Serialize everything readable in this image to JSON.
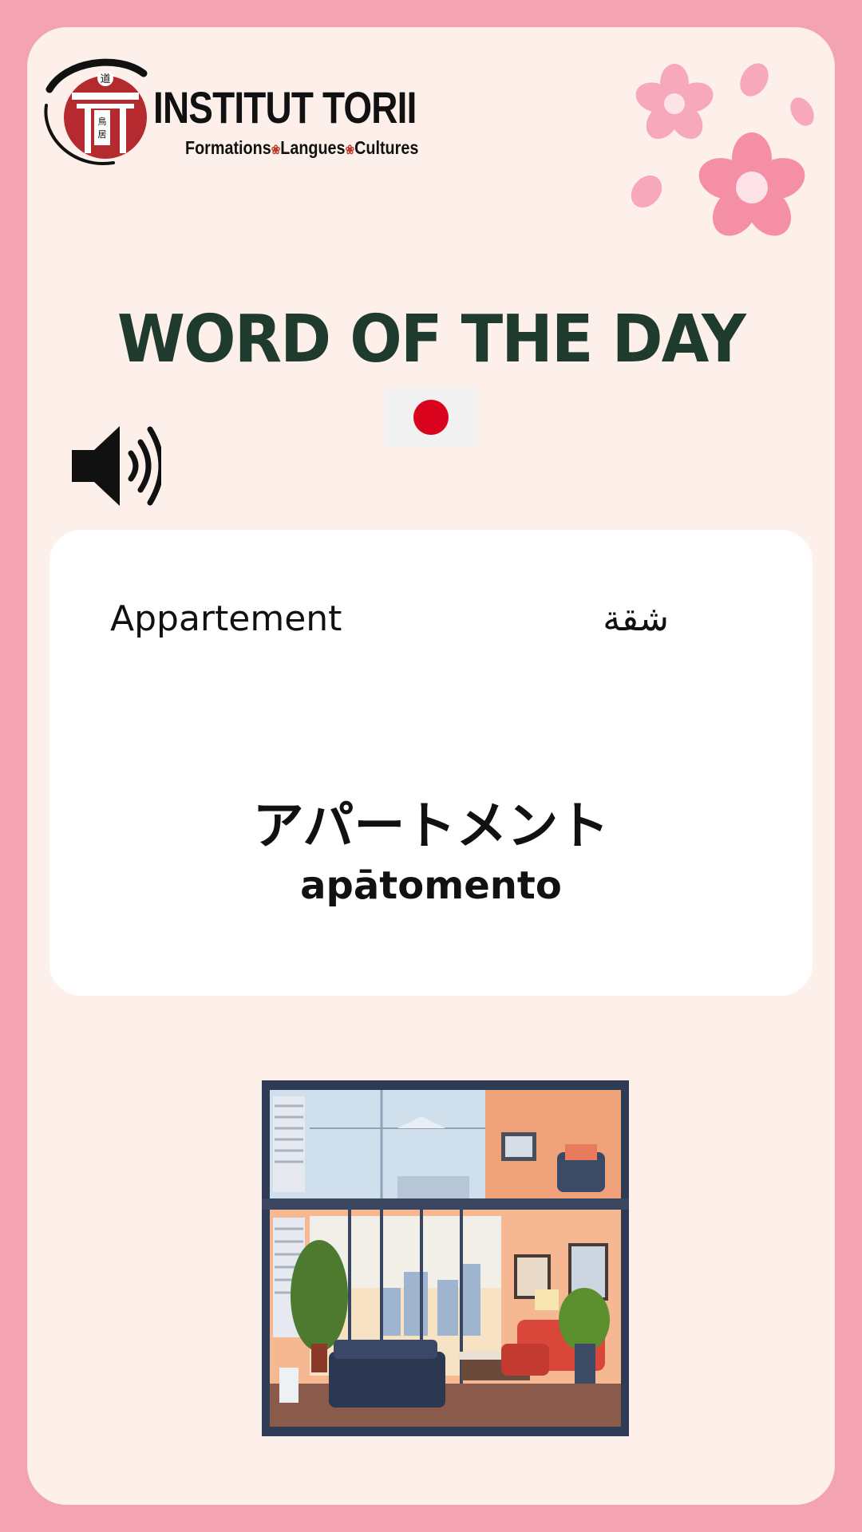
{
  "brand": {
    "name": "INSTITUT TORII",
    "tagline_parts": [
      "Formations",
      "Langues",
      "Cultures"
    ],
    "logo_kanji_top": "道",
    "logo_kanji_side": "鳥居",
    "accent_red": "#c0392b"
  },
  "header": {
    "title": "WORD OF THE DAY",
    "flag_icon": "japan-flag-icon",
    "audio_icon": "speaker-icon"
  },
  "word": {
    "french": "Appartement",
    "arabic": "شقة",
    "japanese": "アパートメント",
    "romaji": "apātomento"
  },
  "colors": {
    "frame": "#f4a3b3",
    "background": "#fdf0ea",
    "title": "#1f3b2d",
    "card": "#ffffff",
    "flag_sun": "#d9031d"
  }
}
